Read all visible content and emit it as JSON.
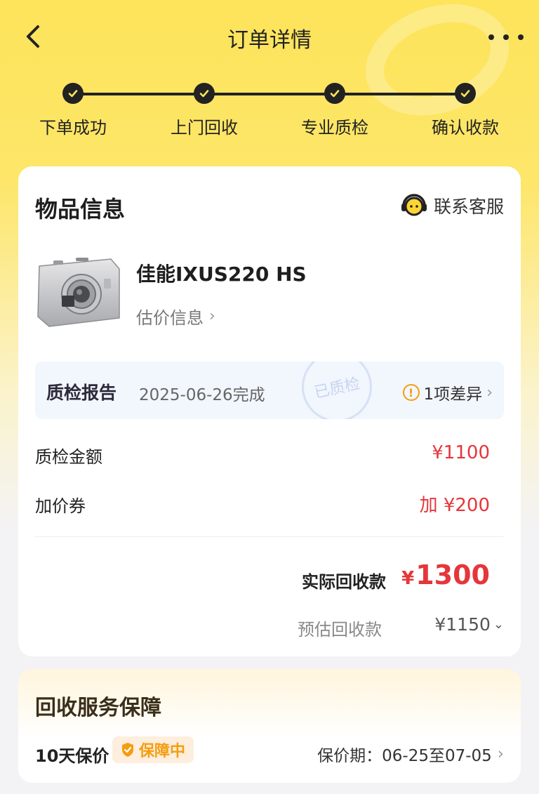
{
  "header": {
    "title": "订单详情"
  },
  "steps": [
    "下单成功",
    "上门回收",
    "专业质检",
    "确认收款"
  ],
  "item_section": {
    "title": "物品信息",
    "customer_service": "联系客服",
    "product_name": "佳能IXUS220 HS",
    "estimate_link": "估价信息"
  },
  "qc_report": {
    "title": "质检报告",
    "date": "2025-06-26完成",
    "stamp": "已质检",
    "difference": "1项差异"
  },
  "amounts": {
    "qc_amount_label": "质检金额",
    "qc_amount_value": "¥1100",
    "coupon_label": "加价券",
    "coupon_value": "加 ¥200",
    "actual_label": "实际回收款",
    "actual_currency": "¥",
    "actual_value": "1300",
    "estimated_label": "预估回收款",
    "estimated_value": "¥1150"
  },
  "guarantee": {
    "title": "回收服务保障",
    "name": "10天保价",
    "badge": "保障中",
    "period": "保价期：06-25至07-05"
  },
  "colors": {
    "accent_red": "#e5363b",
    "brand_yellow": "#fde45a",
    "warning": "#f59d10"
  }
}
